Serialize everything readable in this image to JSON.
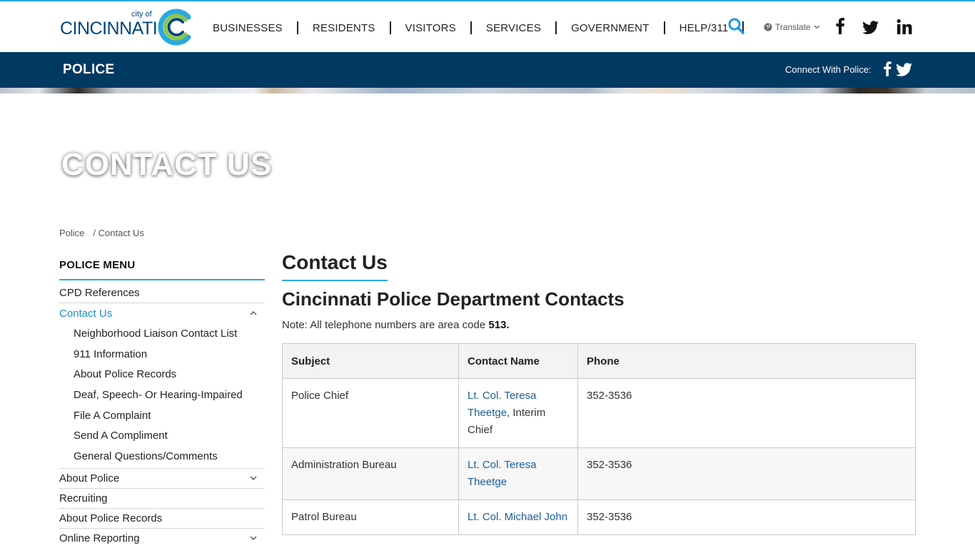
{
  "header": {
    "logo_small": "city of",
    "logo_word": "CINCINNATI",
    "nav": [
      "BUSINESSES",
      "RESIDENTS",
      "VISITORS",
      "SERVICES",
      "GOVERNMENT",
      "HELP/311"
    ],
    "translate_label": "Translate"
  },
  "dept_bar": {
    "title": "POLICE",
    "connect_label": "Connect With Police:"
  },
  "page": {
    "heading": "CONTACT US"
  },
  "breadcrumb": {
    "items": [
      "Police",
      "/ Contact Us"
    ]
  },
  "sidebar": {
    "title": "POLICE MENU",
    "items": [
      "CPD References",
      "Contact Us",
      "About Police",
      "Recruiting",
      "About Police Records",
      "Online Reporting"
    ],
    "sub_items": [
      "Neighborhood Liaison Contact List",
      "911 Information",
      "About Police Records",
      "Deaf, Speech- Or Hearing-Impaired",
      "File A Complaint",
      "Send A Compliment",
      "General Questions/Comments"
    ]
  },
  "main": {
    "title": "Contact Us",
    "section_title": "Cincinnati Police Department Contacts",
    "note_prefix": "Note: All telephone numbers are area code ",
    "note_code": "513."
  },
  "table": {
    "headers": [
      "Subject",
      "Contact Name",
      "Phone"
    ],
    "rows": [
      {
        "subject": "Police Chief",
        "name": "Lt. Col. Teresa Theetge",
        "suffix": ", Interim Chief",
        "phone": "352-3536"
      },
      {
        "subject": "Administration Bureau",
        "name": "Lt. Col. Teresa Theetge",
        "suffix": "",
        "phone": "352-3536"
      },
      {
        "subject": "Patrol Bureau",
        "name": "Lt. Col. Michael John",
        "suffix": "",
        "phone": "352-3536"
      }
    ]
  },
  "colors": {
    "brand_blue": "#003a63",
    "accent": "#2aa9e0",
    "link": "#1a5e9a",
    "active_link": "#1a8ed1"
  },
  "icons": [
    "search-icon",
    "globe-icon",
    "chevron-down-icon",
    "facebook-icon",
    "twitter-icon",
    "linkedin-icon",
    "chevron-up-icon"
  ]
}
